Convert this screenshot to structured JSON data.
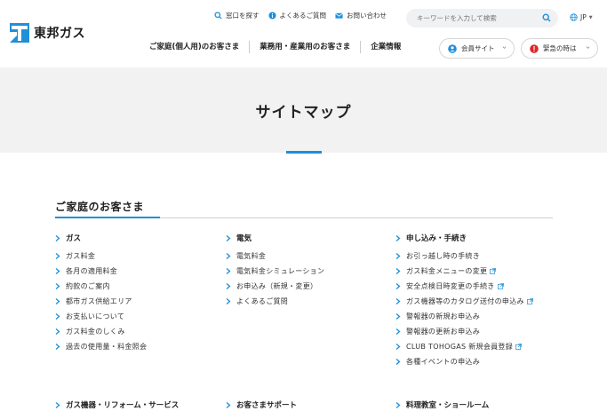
{
  "brand": {
    "name": "東邦ガス",
    "accent": "#1f8fd8"
  },
  "utility": [
    {
      "label": "窓口を探す",
      "icon": "search-icon"
    },
    {
      "label": "よくあるご質問",
      "icon": "info-icon"
    },
    {
      "label": "お問い合わせ",
      "icon": "mail-icon"
    }
  ],
  "search": {
    "placeholder": "キーワードを入力して検索"
  },
  "lang": {
    "label": "JP"
  },
  "gnav": [
    {
      "label": "ご家庭(個人用)のお客さま"
    },
    {
      "label": "業務用・産業用のお客さま"
    },
    {
      "label": "企業情報"
    }
  ],
  "member_button": {
    "label": "会員サイト"
  },
  "emergency_button": {
    "label": "緊急の時は"
  },
  "hero": {
    "title": "サイトマップ"
  },
  "section": {
    "title": "ご家庭のお客さま"
  },
  "columns": [
    {
      "heading": "ガス",
      "links": [
        {
          "label": "ガス料金",
          "external": false
        },
        {
          "label": "各月の適用料金",
          "external": false
        },
        {
          "label": "約款のご案内",
          "external": false
        },
        {
          "label": "都市ガス供給エリア",
          "external": false
        },
        {
          "label": "お支払いについて",
          "external": false
        },
        {
          "label": "ガス料金のしくみ",
          "external": false
        },
        {
          "label": "過去の使用量・料金照会",
          "external": false
        }
      ]
    },
    {
      "heading": "電気",
      "links": [
        {
          "label": "電気料金",
          "external": false
        },
        {
          "label": "電気料金シミュレーション",
          "external": false
        },
        {
          "label": "お申込み（新規・変更）",
          "external": false
        },
        {
          "label": "よくあるご質問",
          "external": false
        }
      ]
    },
    {
      "heading": "申し込み・手続き",
      "links": [
        {
          "label": "お引っ越し時の手続き",
          "external": false
        },
        {
          "label": "ガス料金メニューの変更",
          "external": true
        },
        {
          "label": "安全点検日時変更の手続き",
          "external": true
        },
        {
          "label": "ガス機器等のカタログ送付の申込み",
          "external": true
        },
        {
          "label": "警報器の新規お申込み",
          "external": false
        },
        {
          "label": "警報器の更新お申込み",
          "external": false
        },
        {
          "label": "CLUB TOHOGAS 新規会員登録",
          "external": true
        },
        {
          "label": "各種イベントの申込み",
          "external": false
        }
      ]
    }
  ],
  "bottom_headings": [
    {
      "label": "ガス機器・リフォーム・サービス"
    },
    {
      "label": "お客さまサポート"
    },
    {
      "label": "料理教室・ショールーム"
    }
  ]
}
